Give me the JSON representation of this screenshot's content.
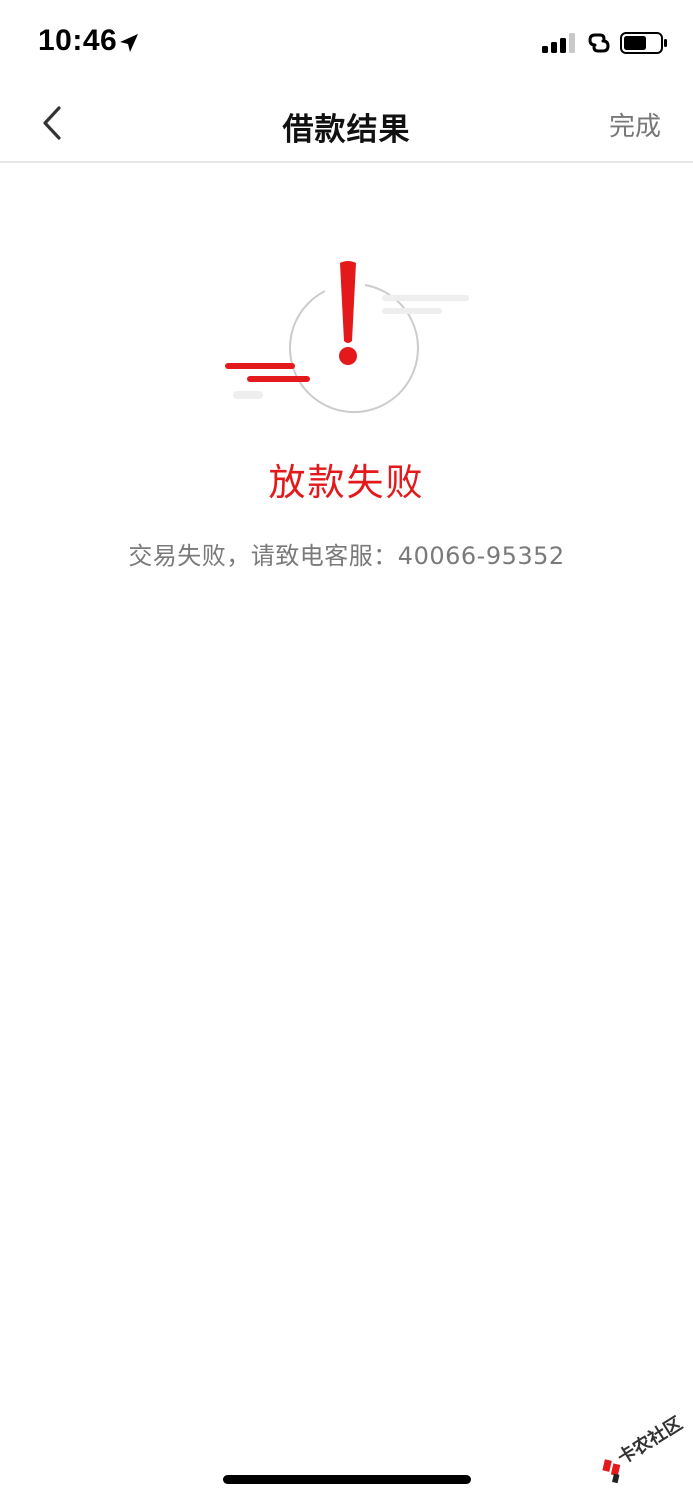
{
  "status_bar": {
    "time": "10:46",
    "icons": [
      "location-arrow-icon",
      "cellular-signal-icon",
      "link-icon",
      "battery-icon"
    ]
  },
  "nav": {
    "back_icon": "chevron-left-icon",
    "title": "借款结果",
    "done_label": "完成"
  },
  "result": {
    "icon": "exclamation-alert-icon",
    "title": "放款失败",
    "description": "交易失败，请致电客服：40066-95352"
  },
  "watermark": {
    "text": "卡农社区"
  },
  "colors": {
    "accent_red": "#e3191b",
    "text_gray": "#7a7a7a",
    "divider": "#e6e6e6",
    "circle_gray": "#cccccc",
    "streak_gray": "#eeeeee"
  }
}
